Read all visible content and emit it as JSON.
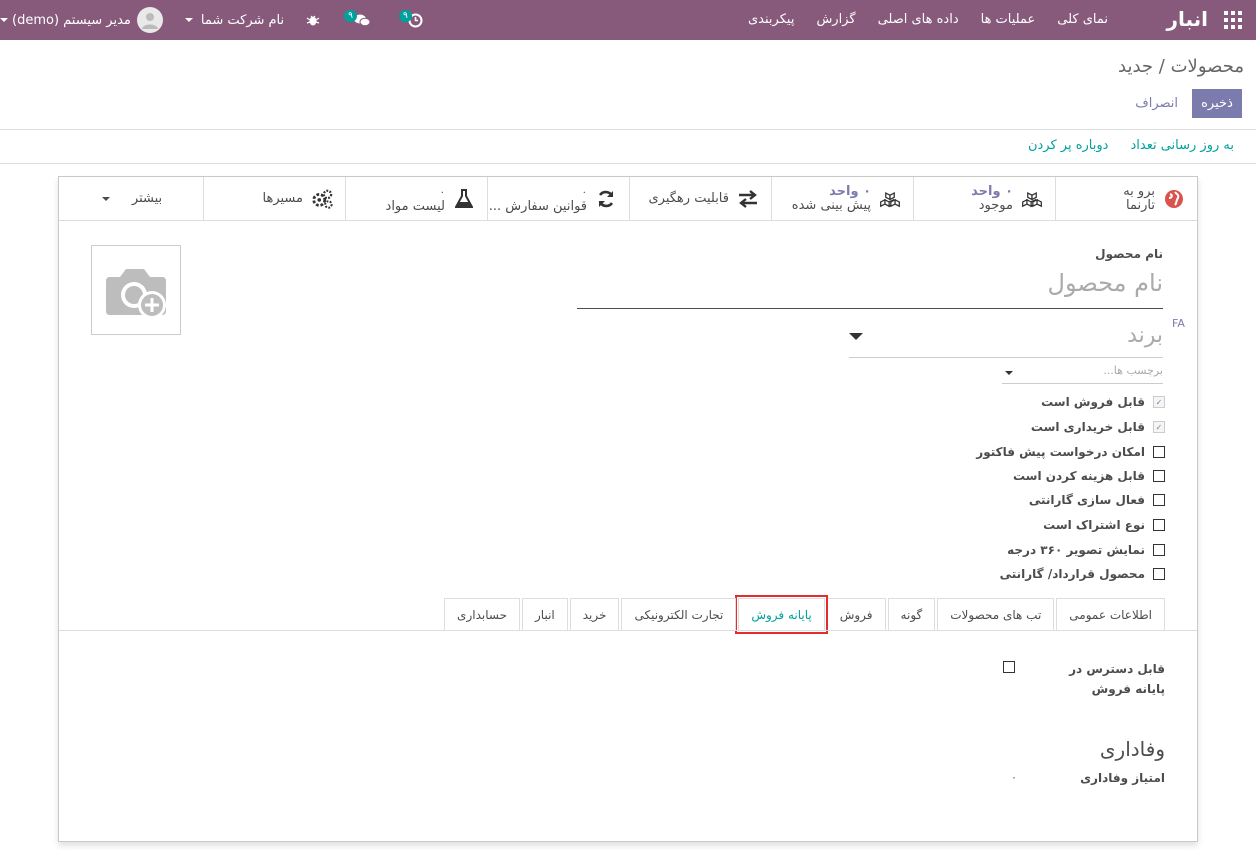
{
  "topbar": {
    "app_name": "انبار",
    "menus": [
      "نمای کلی",
      "عملیات ها",
      "داده های اصلی",
      "گزارش",
      "پیکربندی"
    ],
    "user_name": "مدیر سیستم (demo)",
    "company_name": "نام شرکت شما",
    "messages_count": "۹",
    "activities_count": "۹"
  },
  "breadcrumb": {
    "parent": "محصولات",
    "separator": "/",
    "current": "جدید"
  },
  "actions": {
    "save": "ذخیره",
    "discard": "انصراف"
  },
  "statusbar": {
    "update_qty": "به روز رسانی تعداد",
    "replenish": "دوباره پر کردن"
  },
  "smart_buttons": [
    {
      "label": "برو به",
      "label2": "تارنما",
      "icon": "globe-icon"
    },
    {
      "value": "۰ واحد",
      "label": "موجود",
      "icon": "cubes-icon"
    },
    {
      "value": "۰ واحد",
      "label": "پیش بینی شده",
      "icon": "cubes-icon"
    },
    {
      "label": "قابلیت رهگیری",
      "icon": "exchange-icon"
    },
    {
      "value": "۰",
      "label": "قوانین سفارش ...",
      "icon": "refresh-icon"
    },
    {
      "value": "۰",
      "label": "لیست مواد",
      "icon": "flask-icon"
    },
    {
      "label": "مسیرها",
      "icon": "cogs-icon"
    },
    {
      "label": "بیشتر",
      "icon": "chevron-down-icon"
    }
  ],
  "form": {
    "name_label": "نام محصول",
    "name_placeholder": "نام محصول",
    "lang_badge": "FA",
    "brand_placeholder": "برند",
    "tags_placeholder": "برچسب ها..."
  },
  "checkboxes": [
    {
      "label": "قابل فروش است",
      "checked": true
    },
    {
      "label": "قابل خریداری است",
      "checked": true
    },
    {
      "label": "امکان درخواست پیش فاکتور",
      "checked": false
    },
    {
      "label": "قابل هزینه کردن است",
      "checked": false
    },
    {
      "label": "فعال سازی گارانتی",
      "checked": false
    },
    {
      "label": "نوع اشتراک است",
      "checked": false
    },
    {
      "label": "نمایش تصویر ۳۶۰ درجه",
      "checked": false
    },
    {
      "label": "محصول قرارداد/ گارانتی",
      "checked": false
    }
  ],
  "tabs": [
    {
      "label": "اطلاعات عمومی",
      "active": false
    },
    {
      "label": "تب های محصولات",
      "active": false
    },
    {
      "label": "گونه",
      "active": false
    },
    {
      "label": "فروش",
      "active": false
    },
    {
      "label": "پایانه فروش",
      "active": true
    },
    {
      "label": "تجارت الکترونیکی",
      "active": false
    },
    {
      "label": "خرید",
      "active": false
    },
    {
      "label": "انبار",
      "active": false
    },
    {
      "label": "حسابداری",
      "active": false
    }
  ],
  "pos": {
    "available_label": "قابل دسترس در پایانه فروش",
    "available_checked": false
  },
  "loyalty": {
    "title": "وفاداری",
    "points_label": "امتیاز وفاداری",
    "points_value": "۰"
  }
}
